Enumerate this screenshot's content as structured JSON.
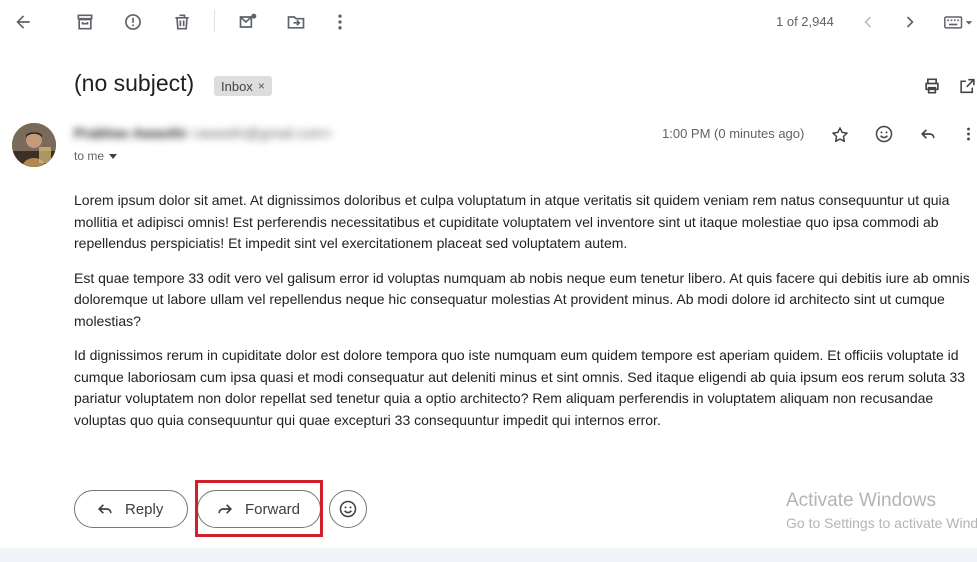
{
  "toolbar": {
    "icons": [
      "back-arrow-icon",
      "archive-icon",
      "report-spam-icon",
      "delete-icon",
      "mark-unread-icon",
      "move-to-icon",
      "more-vert-icon"
    ],
    "pager_text": "1 of 2,944"
  },
  "message": {
    "subject": "(no subject)",
    "label": "Inbox",
    "sender_name": "Prabhav Awasthi",
    "sender_email": "<awasthi@gmail.com>",
    "recipient": "to me",
    "timestamp": "1:00 PM (0 minutes ago)",
    "paragraphs": [
      "Lorem ipsum dolor sit amet. At dignissimos doloribus et culpa voluptatum in atque veritatis sit quidem veniam rem natus consequuntur ut quia mollitia et adipisci omnis! Est perferendis necessitatibus et cupiditate voluptatem vel inventore sint ut itaque molestiae quo ipsa commodi ab repellendus perspiciatis! Et impedit sint vel exercitationem placeat sed voluptatem autem.",
      "Est quae tempore 33 odit vero vel galisum error id voluptas numquam ab nobis neque eum tenetur libero. At quis facere qui debitis iure ab omnis doloremque ut labore ullam vel repellendus neque hic consequatur molestias At provident minus. Ab modi dolore id architecto sint ut cumque molestias?",
      "Id dignissimos rerum in cupiditate dolor est dolore tempora quo iste numquam eum quidem tempore est aperiam quidem. Et officiis voluptate id cumque laboriosam cum ipsa quasi et modi consequatur aut deleniti minus et sint omnis. Sed itaque eligendi ab quia ipsum eos rerum soluta 33 pariatur voluptatem non dolor repellat sed tenetur quia a optio architecto? Rem aliquam perferendis in voluptatem aliquam non recusandae voluptas quo quia consequuntur qui quae excepturi 33 consequuntur impedit qui internos error."
    ]
  },
  "actions": {
    "reply_label": "Reply",
    "forward_label": "Forward"
  },
  "watermark": {
    "line1": "Activate Windows",
    "line2": "Go to Settings to activate Windows."
  },
  "colors": {
    "highlight": "#d0202a",
    "chip_bg": "#dddddd"
  }
}
